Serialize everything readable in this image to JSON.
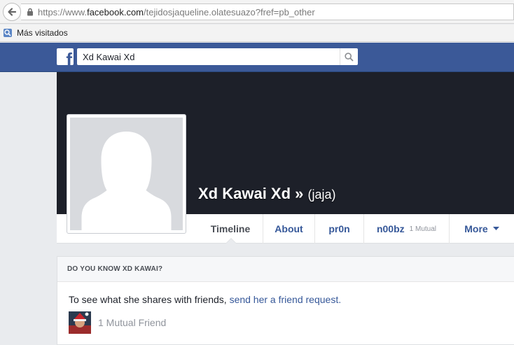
{
  "browser": {
    "url_prefix": "https://www.",
    "url_host": "facebook.com",
    "url_path": "/tejidosjaqueline.olatesuazo?fref=pb_other",
    "bookmarks_label": "Más visitados"
  },
  "header": {
    "logo": "f",
    "search_value": "Xd Kawai Xd"
  },
  "profile": {
    "name": "Xd Kawai Xd",
    "separator": "»",
    "alternate_name": "(jaja)"
  },
  "tabs": [
    {
      "label": "Timeline"
    },
    {
      "label": "About"
    },
    {
      "label": "pr0n"
    },
    {
      "label": "n00bz",
      "mutual": "1 Mutual"
    },
    {
      "label": "More"
    }
  ],
  "know_card": {
    "title": "DO YOU KNOW XD KAWAI?",
    "text": "To see what she shares with friends, ",
    "link": "send her a friend request.",
    "mutual_friends": "1 Mutual Friend"
  },
  "colors": {
    "fb_blue": "#3b5998",
    "link_blue": "#365899",
    "cover_dark": "#1d2029"
  }
}
